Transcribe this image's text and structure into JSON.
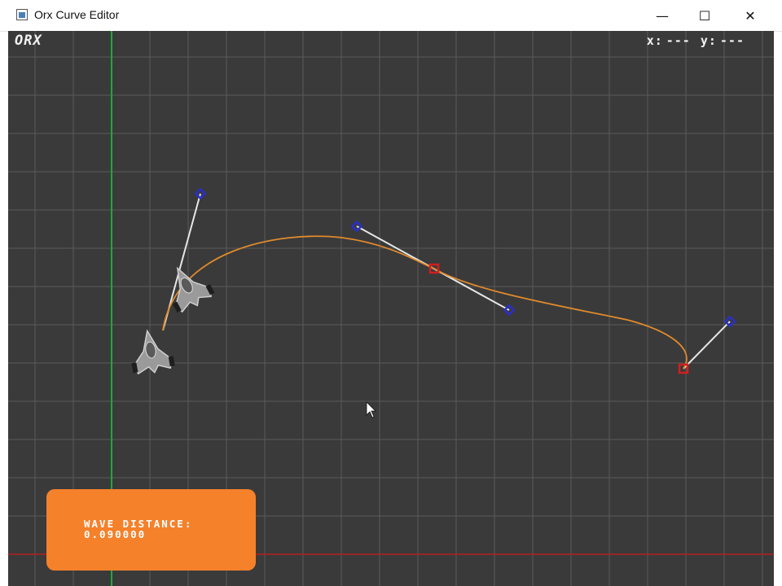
{
  "window": {
    "title": "Orx Curve Editor",
    "minimize_glyph": "—",
    "maximize_glyph": "☐",
    "close_glyph": "✕"
  },
  "hud": {
    "logo": "ORX",
    "x_label": "x:",
    "x_value": "---",
    "y_label": "y:",
    "y_value": "---"
  },
  "info_panel": {
    "label": "WAVE DISTANCE:",
    "value": "0.090000",
    "color": "#F5812B"
  },
  "colors": {
    "background": "#3A3A3A",
    "grid": "#5A5A5A",
    "y_axis": "#1FA83A",
    "x_axis": "#B3201E",
    "curve": "#E08A2C",
    "anchor_point": "#D21E1E",
    "control_point": "#2A2FC8",
    "handle_line": "#E6E6E6"
  },
  "icons": {
    "app": "app-window-icon",
    "cursor": "mouse-pointer-icon",
    "ship": "spaceship-sprite"
  }
}
